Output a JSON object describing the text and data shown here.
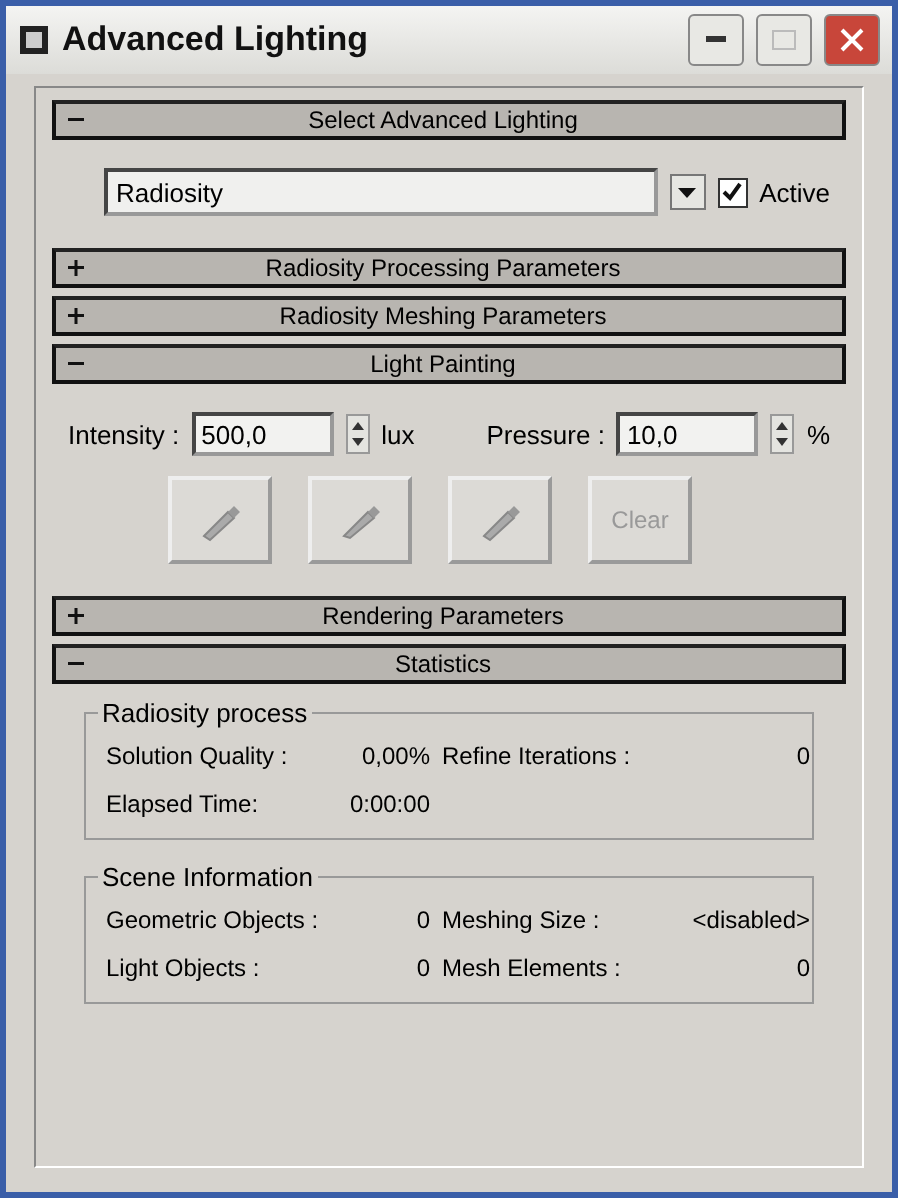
{
  "window": {
    "title": "Advanced Lighting"
  },
  "rollouts": [
    {
      "kind": "select",
      "title": "Select Advanced Lighting",
      "expanded": true,
      "dropdown": {
        "value": "Radiosity"
      },
      "active": {
        "label": "Active",
        "checked": true
      }
    },
    {
      "title": "Radiosity Processing Parameters",
      "expanded": false
    },
    {
      "title": "Radiosity Meshing Parameters",
      "expanded": false
    },
    {
      "kind": "paint",
      "title": "Light Painting",
      "expanded": true,
      "intensity": {
        "label": "Intensity :",
        "value": "500,0",
        "unit": "lux"
      },
      "pressure": {
        "label": "Pressure :",
        "value": "10,0",
        "unit": "%"
      },
      "clear": "Clear"
    },
    {
      "title": "Rendering Parameters",
      "expanded": false
    },
    {
      "kind": "stats",
      "title": "Statistics",
      "expanded": true,
      "groups": [
        {
          "title": "Radiosity process",
          "rows": [
            [
              {
                "label": "Solution Quality :",
                "value": "0,00%"
              },
              {
                "label": "Refine Iterations :",
                "value": "0"
              }
            ],
            [
              {
                "label": "Elapsed Time:",
                "value": "0:00:00"
              }
            ]
          ]
        },
        {
          "title": "Scene Information",
          "rows": [
            [
              {
                "label": "Geometric Objects :",
                "value": "0"
              },
              {
                "label": "Meshing Size :",
                "value": "<disabled>"
              }
            ],
            [
              {
                "label": "Light Objects :",
                "value": "0"
              },
              {
                "label": "Mesh Elements :",
                "value": "0"
              }
            ]
          ]
        }
      ]
    }
  ]
}
